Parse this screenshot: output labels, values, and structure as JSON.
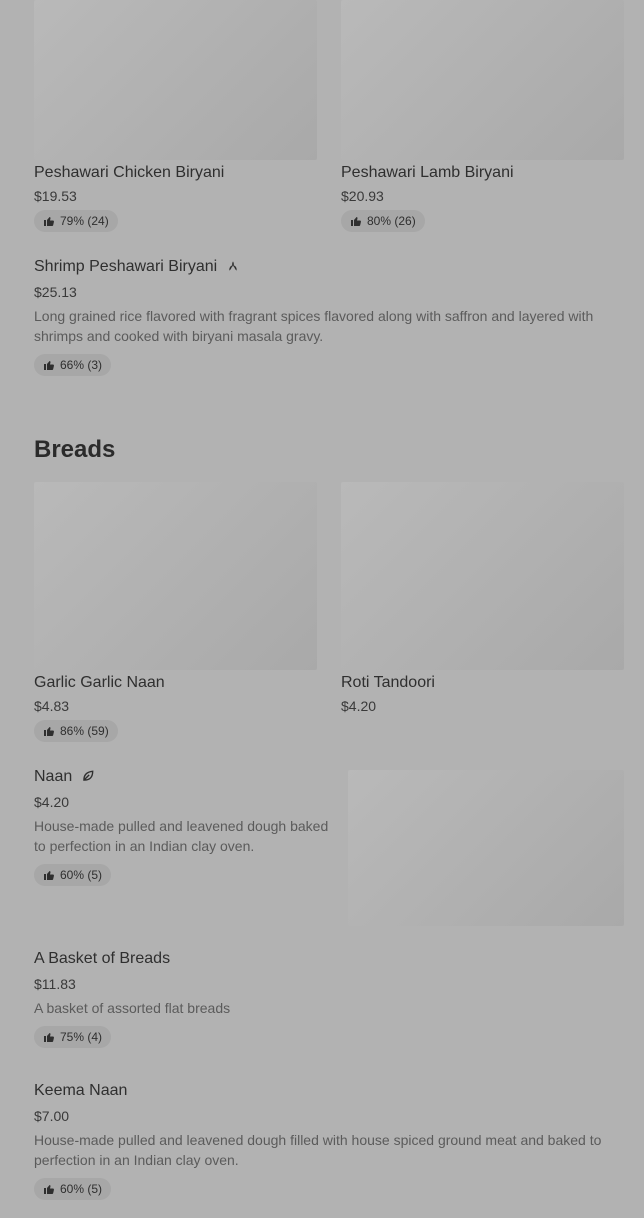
{
  "items_top": [
    {
      "name": "Peshawari Chicken Biryani",
      "price": "$19.53",
      "rating": "79% (24)"
    },
    {
      "name": "Peshawari Lamb Biryani",
      "price": "$20.93",
      "rating": "80% (26)"
    }
  ],
  "shrimp": {
    "name": "Shrimp Peshawari Biryani",
    "tag_icon": "leaf-cluster-icon",
    "price": "$25.13",
    "description": "Long grained rice flavored with fragrant spices flavored along with saffron and layered with shrimps and cooked with biryani masala gravy.",
    "rating": "66% (3)"
  },
  "breads_section": {
    "title": "Breads"
  },
  "bread_cards": [
    {
      "name": "Garlic Garlic Naan",
      "price": "$4.83",
      "rating": "86% (59)"
    },
    {
      "name": "Roti Tandoori",
      "price": "$4.20"
    }
  ],
  "naan": {
    "name": "Naan",
    "tag_icon": "leaf-icon",
    "price": "$4.20",
    "description": "House-made pulled and leavened dough baked to perfection in an Indian clay oven.",
    "rating": "60% (5)"
  },
  "basket": {
    "name": "A Basket of Breads",
    "price": "$11.83",
    "description": "A basket of assorted flat breads",
    "rating": "75% (4)"
  },
  "keema": {
    "name": "Keema Naan",
    "price": "$7.00",
    "description": "House-made pulled and leavened dough filled with house spiced ground meat and baked to perfection in an Indian clay oven.",
    "rating": "60% (5)"
  }
}
